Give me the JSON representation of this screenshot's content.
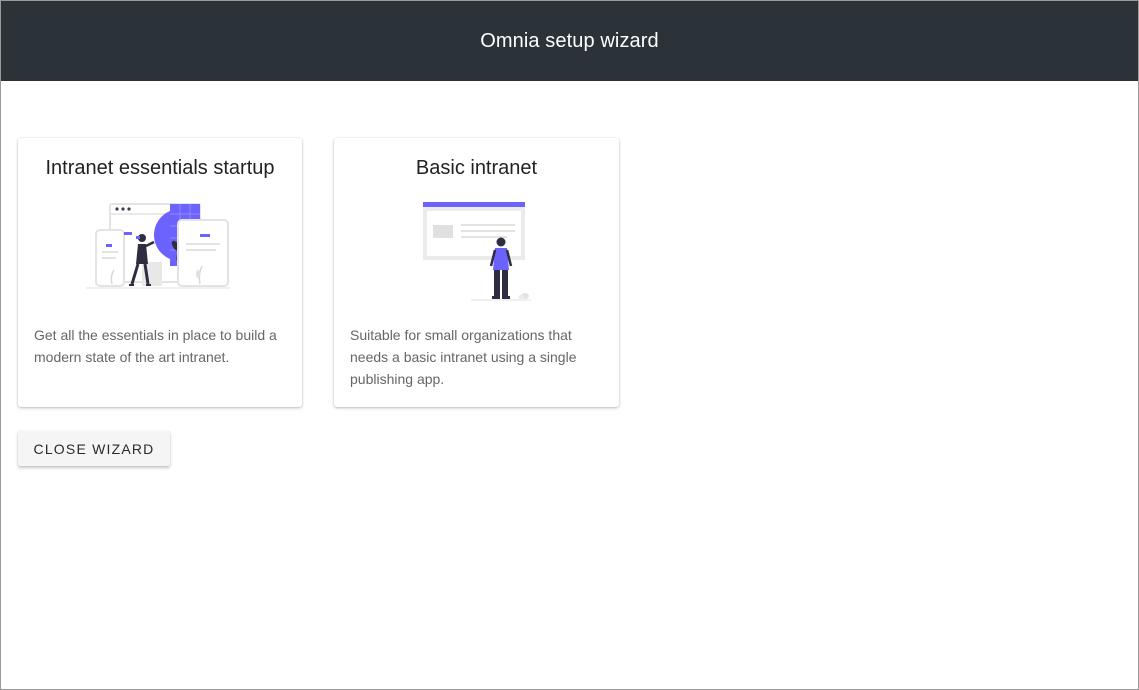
{
  "header": {
    "title": "Omnia setup wizard"
  },
  "cards": [
    {
      "title": "Intranet essentials startup",
      "description": "Get all the essentials in place to build a modern state of the art intranet.",
      "illustration": "person-with-devices-illustration"
    },
    {
      "title": "Basic intranet",
      "description": "Suitable for small organizations that needs a basic intranet using a single publishing app.",
      "illustration": "person-at-webpage-illustration"
    }
  ],
  "actions": {
    "close_label": "CLOSE WIZARD"
  },
  "colors": {
    "header_bg": "#2b3238",
    "accent": "#6c63ff",
    "text_primary": "#222222",
    "text_secondary": "#666666"
  }
}
